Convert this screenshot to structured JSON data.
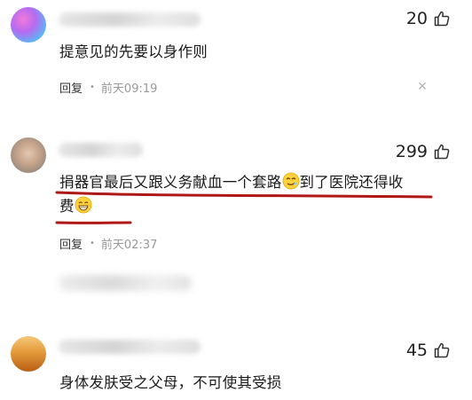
{
  "comments": [
    {
      "likes": "20",
      "text": "提意见的先要以身作则",
      "reply_label": "回复",
      "time": "前天09:19"
    },
    {
      "likes": "299",
      "text_line1_a": "捐器官最后又跟义务献血一个套路",
      "text_line1_b": "到了医院还得收",
      "text_line2": "费",
      "reply_label": "回复",
      "time": "前天02:37"
    },
    {
      "likes": "45",
      "text": "身体发肤受之父母，不可使其受损"
    }
  ],
  "icons": {
    "like": "thumb-up-icon",
    "close": "close-icon",
    "emoji_1": "smirk-emoji",
    "emoji_2": "grin-emoji"
  },
  "colors": {
    "annotation_underline": "#b01818",
    "meta_gray": "#999999"
  }
}
